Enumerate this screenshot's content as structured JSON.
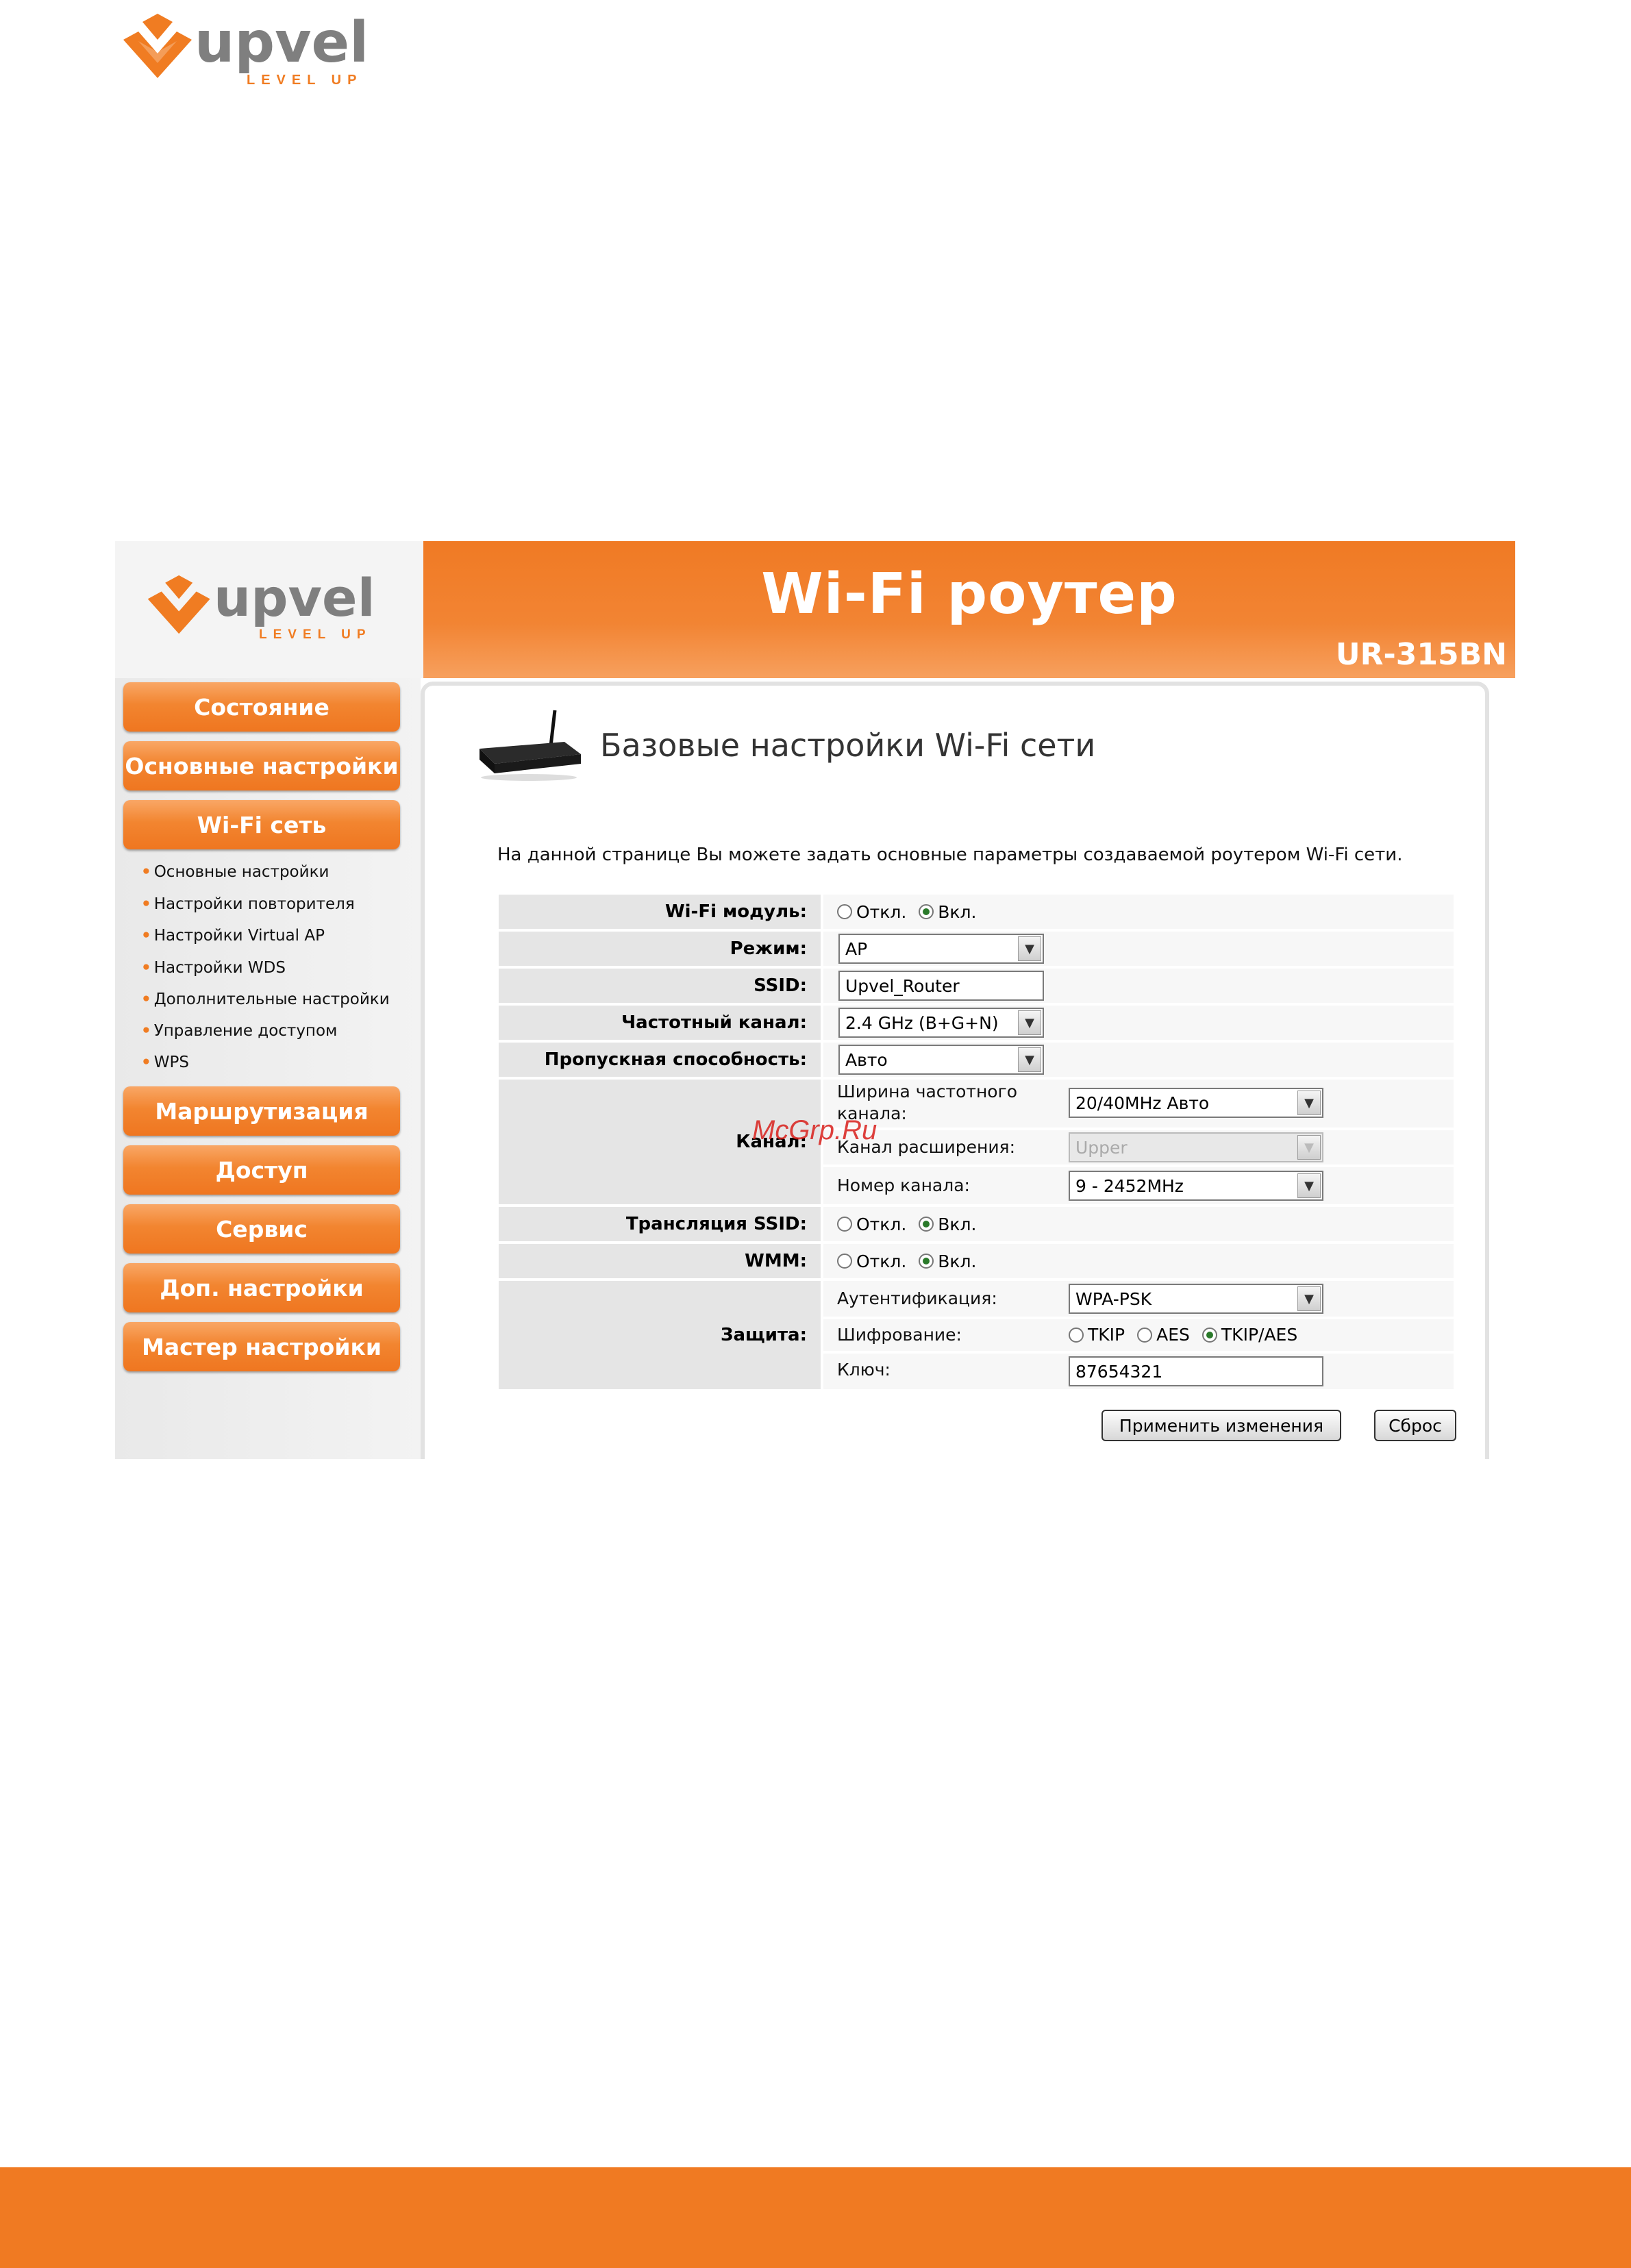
{
  "brand": {
    "name": "upvel",
    "tagline": "LEVEL UP",
    "accent_color": "#f07c22"
  },
  "header": {
    "title": "Wi-Fi роутер",
    "model": "UR-315BN"
  },
  "sidebar": {
    "buttons": [
      "Состояние",
      "Основные настройки",
      "Wi-Fi сеть",
      "Маршрутизация",
      "Доступ",
      "Сервис",
      "Доп. настройки",
      "Мастер настройки"
    ],
    "subitems": [
      "Основные настройки",
      "Настройки повторителя",
      "Настройки Virtual AP",
      "Настройки WDS",
      "Дополнительные настройки",
      "Управление доступом",
      "WPS"
    ]
  },
  "page": {
    "heading": "Базовые настройки Wi-Fi сети",
    "intro": "На данной странице Вы можете задать основные параметры создаваемой роутером Wi-Fi сети."
  },
  "form": {
    "wifi_module": {
      "label": "Wi-Fi модуль:",
      "off": "Откл.",
      "on": "Вкл.",
      "selected": "on"
    },
    "mode": {
      "label": "Режим:",
      "value": "AP"
    },
    "ssid": {
      "label": "SSID:",
      "value": "Upvel_Router"
    },
    "band": {
      "label": "Частотный канал:",
      "value": "2.4 GHz (B+G+N)"
    },
    "bandwidth": {
      "label": "Пропускная способность:",
      "value": "Авто"
    },
    "channel": {
      "label": "Канал:",
      "width_label": "Ширина частотного канала:",
      "width_value": "20/40MHz Авто",
      "ext_label": "Канал расширения:",
      "ext_value": "Upper",
      "number_label": "Номер канала:",
      "number_value": "9 - 2452MHz"
    },
    "ssid_broadcast": {
      "label": "Трансляция SSID:",
      "off": "Откл.",
      "on": "Вкл.",
      "selected": "on"
    },
    "wmm": {
      "label": "WMM:",
      "off": "Откл.",
      "on": "Вкл.",
      "selected": "on"
    },
    "security": {
      "label": "Защита:",
      "auth_label": "Аутентификация:",
      "auth_value": "WPA-PSK",
      "enc_label": "Шифрование:",
      "enc_options": [
        "TKIP",
        "AES",
        "TKIP/AES"
      ],
      "enc_selected": "TKIP/AES",
      "key_label": "Ключ:",
      "key_value": "87654321"
    },
    "apply_button": "Применить изменения",
    "reset_button": "Сброс"
  },
  "watermark": "McGrp.Ru"
}
